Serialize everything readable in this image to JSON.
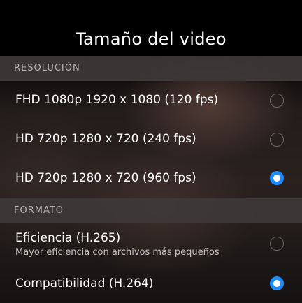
{
  "header": {
    "title": "Tamaño del video"
  },
  "resolution_section": {
    "label": "RESOLUCIÓN",
    "options": [
      {
        "label": "FHD 1080p 1920 x 1080 (120 fps)",
        "selected": false
      },
      {
        "label": "HD 720p 1280 x 720 (240 fps)",
        "selected": false
      },
      {
        "label": "HD 720p 1280 x 720 (960 fps)",
        "selected": true
      }
    ]
  },
  "format_section": {
    "label": "FORMATO",
    "options": [
      {
        "label": "Eficiencia (H.265)",
        "sublabel": "Mayor eficiencia con archivos más pequeños",
        "selected": false
      },
      {
        "label": "Compatibilidad (H.264)",
        "selected": true
      }
    ]
  },
  "colors": {
    "accent": "#1e8cff",
    "section_header_bg": "#3e3a3a",
    "header_bg": "#000000"
  }
}
